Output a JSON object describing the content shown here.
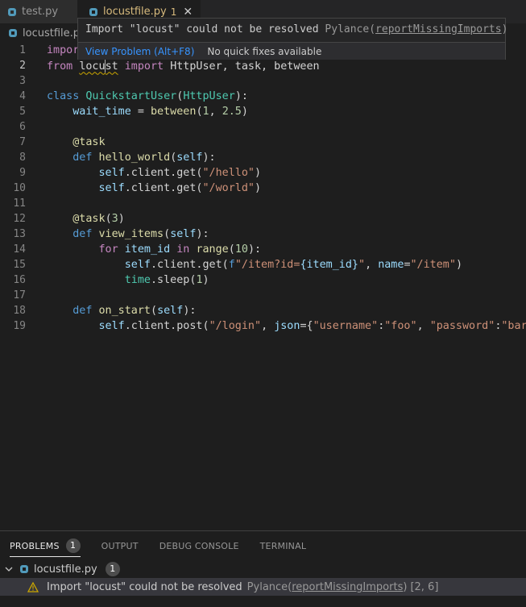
{
  "tabs": [
    {
      "label": "test.py",
      "active": false
    },
    {
      "label": "locustfile.py",
      "active": true,
      "problem_count": "1",
      "close_glyph": "✕"
    }
  ],
  "breadcrumb": {
    "file": "locustfile.py"
  },
  "hover": {
    "message": "Import \"locust\" could not be resolved",
    "source": "Pylance",
    "rule": "reportMissingImports",
    "view_problem": "View Problem (Alt+F8)",
    "no_fixes": "No quick fixes available"
  },
  "editor": {
    "current_line": 2,
    "line_numbers": [
      "1",
      "2",
      "3",
      "4",
      "5",
      "6",
      "7",
      "8",
      "9",
      "10",
      "11",
      "12",
      "13",
      "14",
      "15",
      "16",
      "17",
      "18",
      "19"
    ],
    "line1": {
      "kw": "impor"
    },
    "line2": {
      "from": "from",
      "mod_a": "locu",
      "mod_b": "st",
      "import": "import",
      "rest": "HttpUser, task, between"
    },
    "line4": {
      "kw": "class",
      "name": "QuickstartUser",
      "base": "HttpUser",
      "end": "):"
    },
    "line5": {
      "var": "wait_time",
      "op": " = ",
      "fn": "between",
      "a": "1",
      "b": "2.5"
    },
    "line7": {
      "dec": "@task"
    },
    "line8": {
      "kw": "def",
      "fn": "hello_world",
      "arg": "self",
      "end": "):"
    },
    "line9": {
      "self": "self",
      "attr": ".client.get(",
      "str": "\"/hello\"",
      "end": ")"
    },
    "line10": {
      "self": "self",
      "attr": ".client.get(",
      "str": "\"/world\"",
      "end": ")"
    },
    "line12": {
      "dec": "@task",
      "num": "3"
    },
    "line13": {
      "kw": "def",
      "fn": "view_items",
      "arg": "self",
      "end": "):"
    },
    "line14": {
      "kw": "for",
      "var": "item_id",
      "in": "in",
      "fn": "range",
      "num": "10",
      "end": "):"
    },
    "line15": {
      "self": "self",
      "attr": ".client.get(",
      "f": "f",
      "str1": "\"/item?id=",
      "ph": "{item_id}",
      "str2": "\"",
      "kw": "name",
      "str3": "\"/item\"",
      "end": ")"
    },
    "line16": {
      "mod": "time",
      "attr": ".sleep(",
      "num": "1",
      "end": ")"
    },
    "line18": {
      "kw": "def",
      "fn": "on_start",
      "arg": "self",
      "end": "):"
    },
    "line19": {
      "self": "self",
      "attr": ".client.post(",
      "str1": "\"/login\"",
      "kw": "json",
      "k1": "\"username\"",
      "v1": "\"foo\"",
      "k2": "\"password\"",
      "v2": "\"bar\"",
      "end": "})"
    }
  },
  "panel": {
    "tabs": [
      {
        "label": "PROBLEMS",
        "count": "1",
        "active": true
      },
      {
        "label": "OUTPUT"
      },
      {
        "label": "DEBUG CONSOLE"
      },
      {
        "label": "TERMINAL"
      }
    ],
    "file": {
      "name": "locustfile.py",
      "count": "1"
    },
    "issue": {
      "message": "Import \"locust\" could not be resolved",
      "source": "Pylance",
      "rule": "reportMissingImports",
      "position": "[2, 6]"
    }
  },
  "colors": {
    "accent": "#3794ff",
    "warning": "#cca700",
    "tab_modified": "#d7ba7d"
  }
}
